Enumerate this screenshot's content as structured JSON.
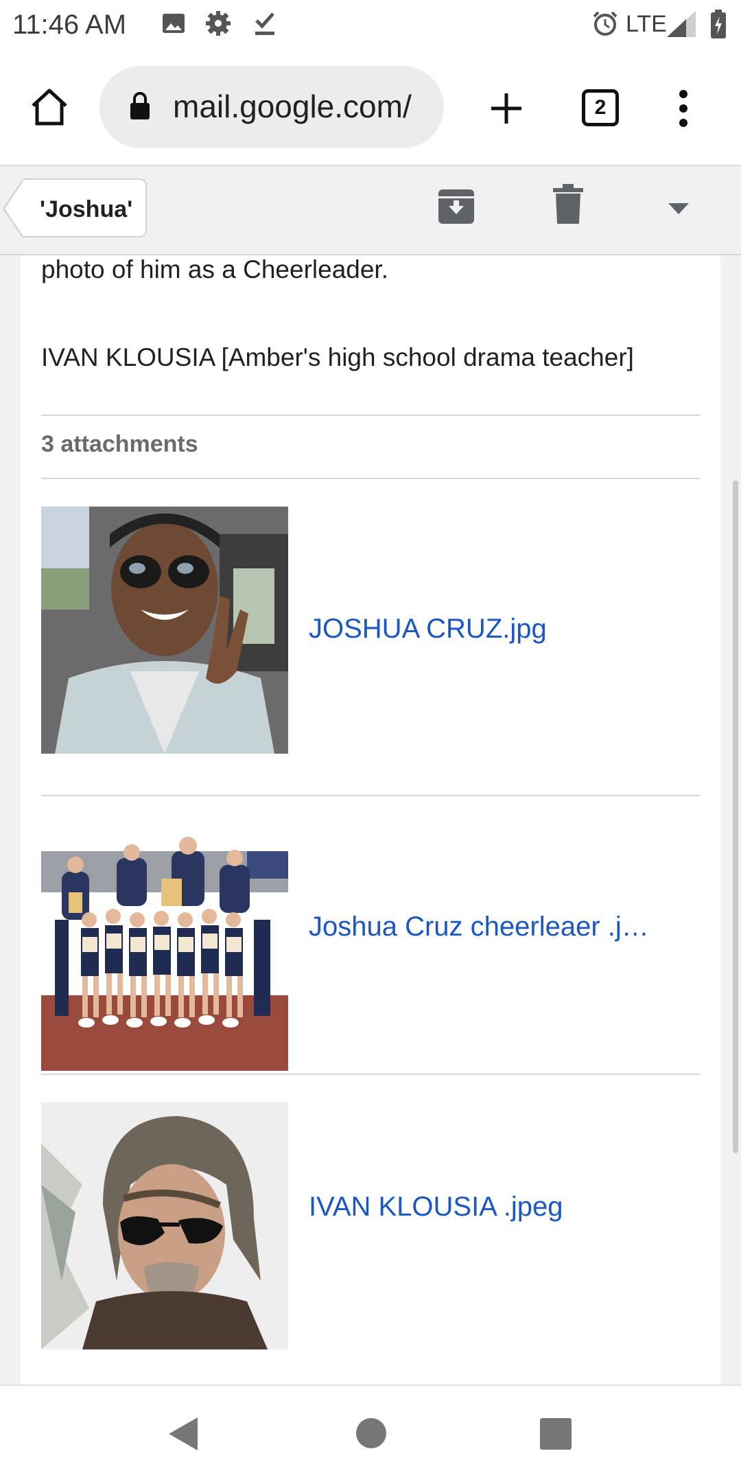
{
  "status_bar": {
    "time": "11:46 AM",
    "network": "LTE"
  },
  "browser": {
    "url": "mail.google.com/",
    "tab_count": "2"
  },
  "toolbar": {
    "label": "'Joshua'"
  },
  "message": {
    "body_lines": [
      "photo of him as a Cheerleader.",
      "IVAN KLOUSIA [Amber's high school drama teacher]"
    ]
  },
  "attachments": {
    "count_label": "3 attachments",
    "items": [
      {
        "name": "JOSHUA CRUZ.jpg"
      },
      {
        "name": "Joshua Cruz cheerleaer .j…"
      },
      {
        "name": "IVAN KLOUSIA .jpeg"
      }
    ]
  },
  "colors": {
    "link": "#1a57c2",
    "page_bg": "#f1f1f1"
  }
}
